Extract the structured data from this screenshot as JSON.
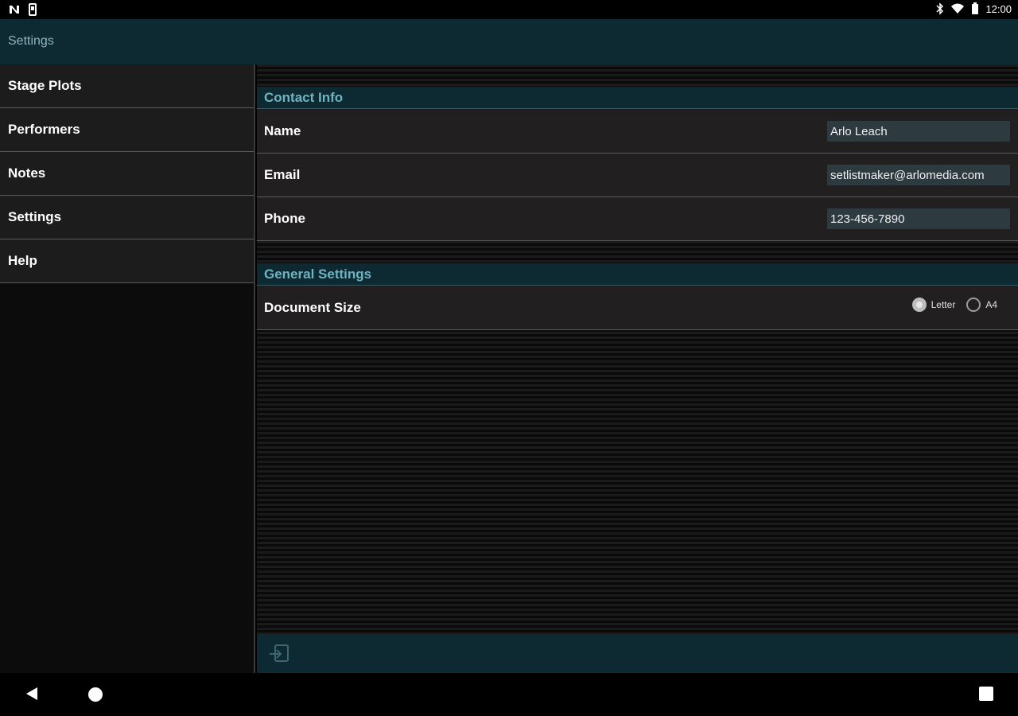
{
  "status_bar": {
    "time": "12:00",
    "left_icons": [
      "n-notification-icon",
      "sim-card-icon"
    ],
    "right_icons": [
      "bluetooth-icon",
      "wifi-icon",
      "battery-icon"
    ]
  },
  "app_bar": {
    "title": "Settings"
  },
  "sidebar": {
    "items": [
      {
        "label": "Stage Plots"
      },
      {
        "label": "Performers"
      },
      {
        "label": "Notes"
      },
      {
        "label": "Settings"
      },
      {
        "label": "Help"
      }
    ]
  },
  "contact_info": {
    "header": "Contact Info",
    "name": {
      "label": "Name",
      "value": "Arlo Leach"
    },
    "email": {
      "label": "Email",
      "value": "setlistmaker@arlomedia.com"
    },
    "phone": {
      "label": "Phone",
      "value": "123-456-7890"
    }
  },
  "general_settings": {
    "header": "General Settings",
    "document_size": {
      "label": "Document Size",
      "options": [
        "Letter",
        "A4"
      ],
      "selected": "Letter"
    }
  },
  "bottom_bar": {
    "icons": [
      "export-icon"
    ]
  },
  "nav_bar": {
    "icons": [
      "back-icon",
      "home-icon",
      "recents-icon"
    ]
  },
  "colors": {
    "accent": "#0d2a33",
    "section_text": "#6fb3c1",
    "row_background": "#211f1f"
  }
}
